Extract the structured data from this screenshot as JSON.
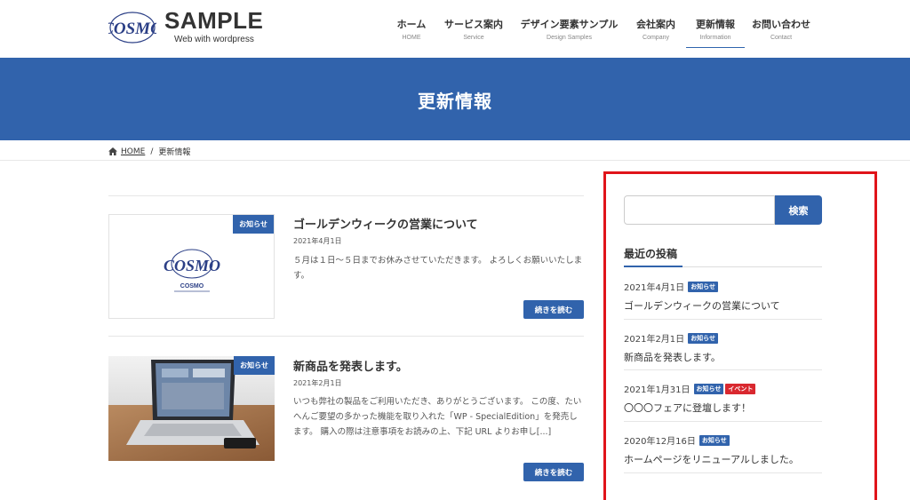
{
  "header": {
    "logo_text": "COSMO",
    "site_title": "SAMPLE",
    "tagline": "Web with wordpress"
  },
  "nav": [
    {
      "label": "ホーム",
      "sub": "HOME"
    },
    {
      "label": "サービス案内",
      "sub": "Service"
    },
    {
      "label": "デザイン要素サンプル",
      "sub": "Design Samples"
    },
    {
      "label": "会社案内",
      "sub": "Company"
    },
    {
      "label": "更新情報",
      "sub": "Information",
      "active": true
    },
    {
      "label": "お問い合わせ",
      "sub": "Contact"
    }
  ],
  "hero": {
    "title": "更新情報"
  },
  "breadcrumb": {
    "home": "HOME",
    "separator": "/",
    "current": "更新情報"
  },
  "posts": [
    {
      "category": "お知らせ",
      "title": "ゴールデンウィークの営業について",
      "date": "2021年4月1日",
      "excerpt": "５月は１日～５日までお休みさせていただきます。 よろしくお願いいたします。",
      "thumb_logo": "COSMO",
      "thumb_logo_sub": "COSMO",
      "more": "続きを読む"
    },
    {
      "category": "お知らせ",
      "title": "新商品を発表します。",
      "date": "2021年2月1日",
      "excerpt": "いつも弊社の製品をご利用いただき、ありがとうございます。 この度、たいへんご要望の多かった機能を取り入れた「WP - SpecialEdition」を発売します。 購入の際は注意事項をお読みの上、下記 URL よりお申し[...]",
      "more": "続きを読む"
    }
  ],
  "sidebar": {
    "search_button": "検索",
    "search_placeholder": "",
    "recent_title": "最近の投稿",
    "recent": [
      {
        "date": "2021年4月1日",
        "cats": [
          "お知らせ"
        ],
        "title": "ゴールデンウィークの営業について"
      },
      {
        "date": "2021年2月1日",
        "cats": [
          "お知らせ"
        ],
        "title": "新商品を発表します。"
      },
      {
        "date": "2021年1月31日",
        "cats": [
          "お知らせ",
          "イベント"
        ],
        "title": "〇〇〇フェアに登壇します！"
      },
      {
        "date": "2020年12月16日",
        "cats": [
          "お知らせ"
        ],
        "title": "ホームページをリニューアルしました。"
      }
    ]
  },
  "colors": {
    "primary": "#3163ac",
    "event": "#d9282f",
    "highlight_box": "#e0141a"
  }
}
